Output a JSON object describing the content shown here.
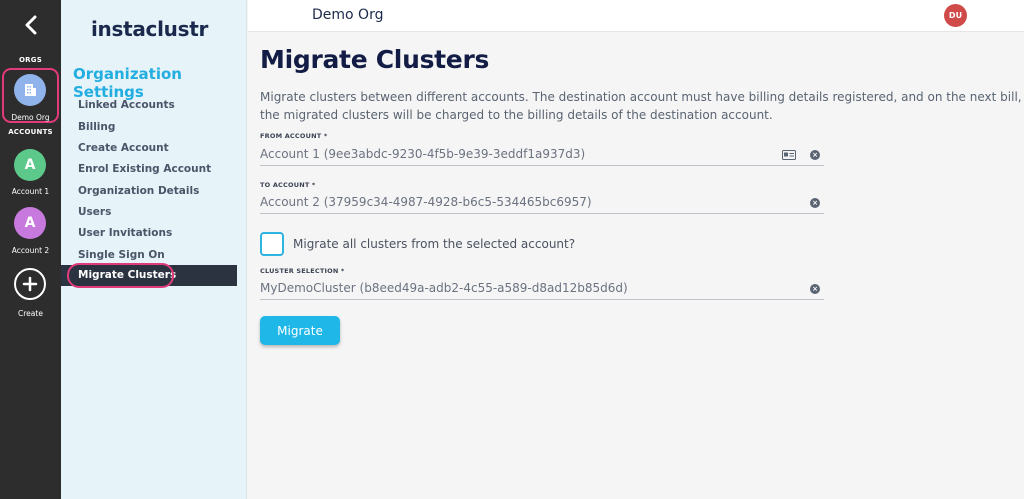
{
  "rail": {
    "orgs_label": "ORGS",
    "org_name": "Demo Org",
    "accounts_label": "ACCOUNTS",
    "accounts": [
      {
        "initial": "A",
        "name": "Account 1",
        "color": "#5cc98b"
      },
      {
        "initial": "A",
        "name": "Account 2",
        "color": "#c779dd"
      }
    ],
    "create_label": "Create"
  },
  "sidebar": {
    "logo": "instaclustr",
    "title": "Organization Settings",
    "items": [
      {
        "label": "Linked Accounts"
      },
      {
        "label": "Billing"
      },
      {
        "label": "Create Account"
      },
      {
        "label": "Enrol Existing Account"
      },
      {
        "label": "Organization Details"
      },
      {
        "label": "Users"
      },
      {
        "label": "User Invitations"
      },
      {
        "label": "Single Sign On"
      },
      {
        "label": "Migrate Clusters"
      }
    ]
  },
  "header": {
    "org_name": "Demo Org",
    "avatar_initials": "DU"
  },
  "main": {
    "title": "Migrate Clusters",
    "description": "Migrate clusters between different accounts. The destination account must have billing details registered, and on the next bill, the migrated clusters will be charged to the billing details of the destination account.",
    "from_label": "FROM ACCOUNT *",
    "from_value": "Account 1 (9ee3abdc-9230-4f5b-9e39-3eddf1a937d3)",
    "to_label": "TO ACCOUNT *",
    "to_value": "Account 2 (37959c34-4987-4928-b6c5-534465bc6957)",
    "checkbox_label": "Migrate all clusters from the selected account?",
    "cluster_label": "CLUSTER SELECTION *",
    "cluster_value": "MyDemoCluster (b8eed49a-adb2-4c55-a589-d8ad12b85d6d)",
    "button_label": "Migrate"
  },
  "colors": {
    "accent": "#1fb6e8",
    "highlight": "#e23a7a",
    "rail_bg": "#2d2d2d",
    "sidebar_bg": "#e6f3f9"
  }
}
